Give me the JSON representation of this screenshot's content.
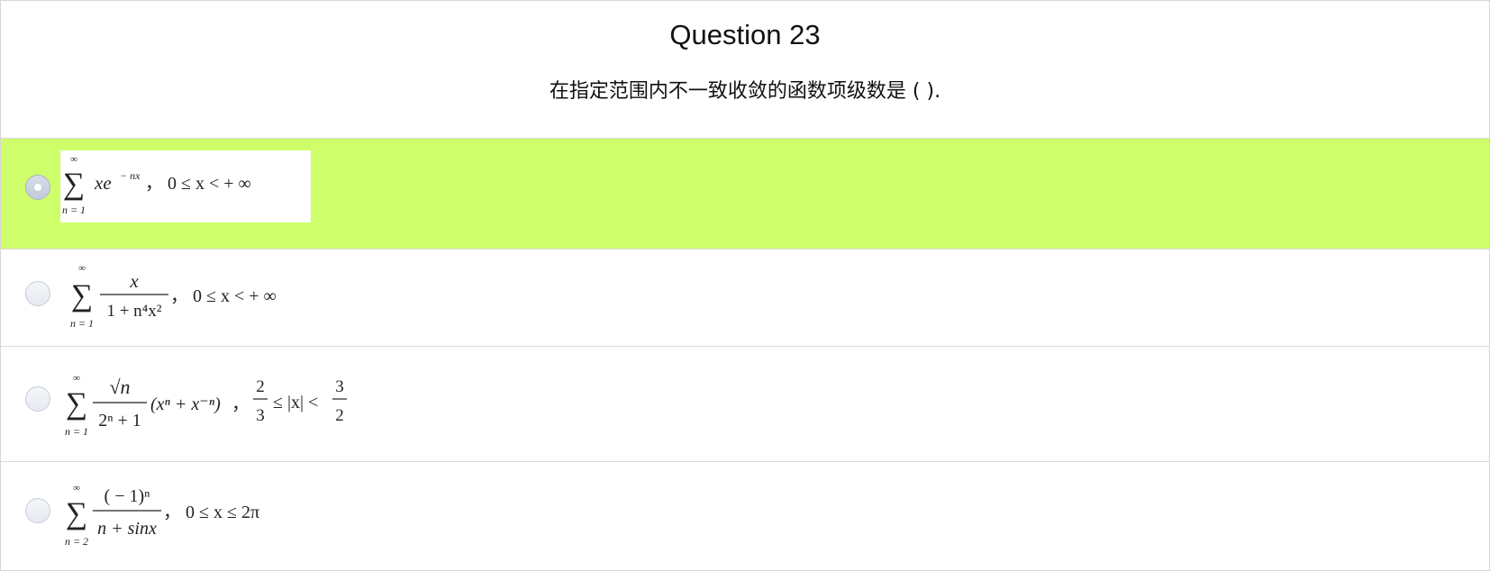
{
  "question": {
    "title": "Question 23",
    "stem": "在指定范围内不一致收敛的函数项级数是 ( )."
  },
  "options": [
    {
      "id": "A",
      "selected": true,
      "sum_top": "∞",
      "sum_bottom": "n = 1",
      "term": "xe",
      "term_sup": "− nx",
      "range": "，  0 ≤ x < + ∞"
    },
    {
      "id": "B",
      "selected": false,
      "sum_top": "∞",
      "sum_bottom": "n = 1",
      "numerator": "x",
      "denominator": "1 + n⁴x²",
      "range": "，  0 ≤ x < + ∞"
    },
    {
      "id": "C",
      "selected": false,
      "sum_top": "∞",
      "sum_bottom": "n = 1",
      "numerator": "√n",
      "denominator": "2ⁿ + 1",
      "factor": "(xⁿ + x⁻ⁿ)",
      "range_prefix": "，",
      "range_left_num": "2",
      "range_left_den": "3",
      "range_mid": "≤ |x| <",
      "range_right_num": "3",
      "range_right_den": "2"
    },
    {
      "id": "D",
      "selected": false,
      "sum_top": "∞",
      "sum_bottom": "n = 2",
      "numerator": "( − 1)ⁿ",
      "denominator": "n + sinx",
      "range": "，  0 ≤ x ≤ 2π"
    }
  ]
}
